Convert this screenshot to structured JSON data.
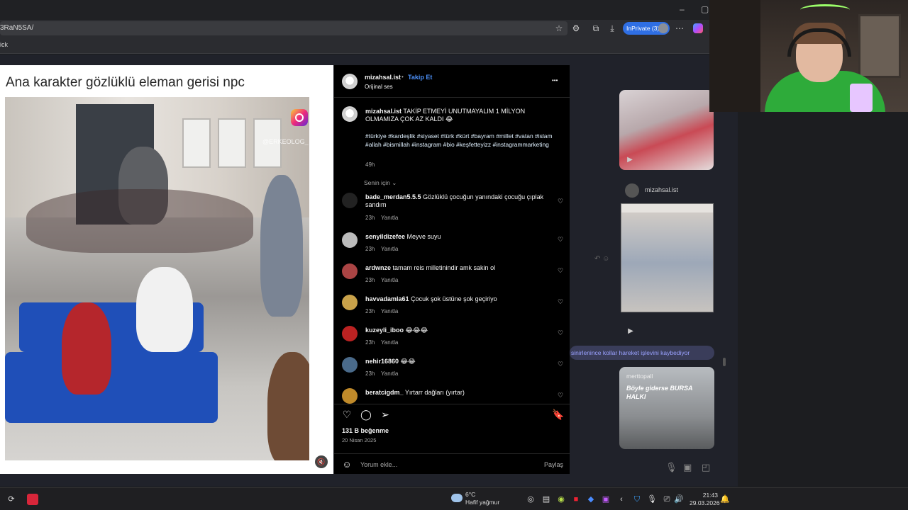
{
  "browser": {
    "url": "3RaN5SA/",
    "inprivate_label": "InPrivate (3)",
    "favorites_item": "ick",
    "window_controls": {
      "minimize": "–",
      "maximize": "▢"
    }
  },
  "post": {
    "caption_title": "Ana karakter gözlüklü eleman gerisi npc",
    "watermark": "@ERKEOLOG_",
    "mute_icon": "🔇",
    "account": {
      "username": "mizahsal.ist",
      "separator": "•",
      "follow_label": "Takip Et",
      "audio": "Orijinal ses",
      "more_icon": "•••"
    },
    "description": {
      "username": "mizahsal.ist",
      "text": "TAKİP ETMEYİ UNUTMAYALIM 1 MİLYON OLMAMIZA ÇOK AZ KALDI 😂",
      "hashtags": "#türkiye #kardeşlik #siyaset #türk #kürt #bayram #millet #vatan #islam #allah #bismillah #instagram #bio #keşfetteyizz #instagrammarketing",
      "age": "49h"
    },
    "sort_label": "Senin için",
    "comments": [
      {
        "username": "bade_merdan5.5.5",
        "text": "Gözlüklü çocuğun yanındaki çocuğu çıplak sandım",
        "age": "23h",
        "reply": "Yanıtla"
      },
      {
        "username": "senyildizefee",
        "text": "Meyve suyu",
        "age": "23h",
        "reply": "Yanıtla"
      },
      {
        "username": "ardwnze",
        "text": "tamam reis milletinindir amk sakin ol",
        "age": "23h",
        "reply": "Yanıtla"
      },
      {
        "username": "havvadamla61",
        "text": "Çocuk şok üstüne şok geçiriyo",
        "age": "23h",
        "reply": "Yanıtla"
      },
      {
        "username": "kuzeyli_iboo",
        "text": "😂😂😂",
        "age": "23h",
        "reply": "Yanıtla"
      },
      {
        "username": "nehir16860",
        "text": "😂😂",
        "age": "23h",
        "reply": "Yanıtla"
      },
      {
        "username": "beratcigdm_",
        "text": "Yırtarr dağları (yırtar)",
        "age": "",
        "reply": ""
      }
    ],
    "likes": "131 B beğenme",
    "date": "20 Nisan 2025",
    "add_comment_placeholder": "Yorum ekle...",
    "share_label": "Paylaş"
  },
  "chat": {
    "sender_name": "mizahsal.ist",
    "bubble_text": "sinirlenince kollar hareket işlevini kaybediyor",
    "reel_user": "merttopall",
    "reel_text": "Böyle giderse BURSA HALKI"
  },
  "taskbar": {
    "temperature": "6°C",
    "weather_desc": "Hafif yağmur",
    "time": "21:43",
    "date": "29.03.2026"
  }
}
